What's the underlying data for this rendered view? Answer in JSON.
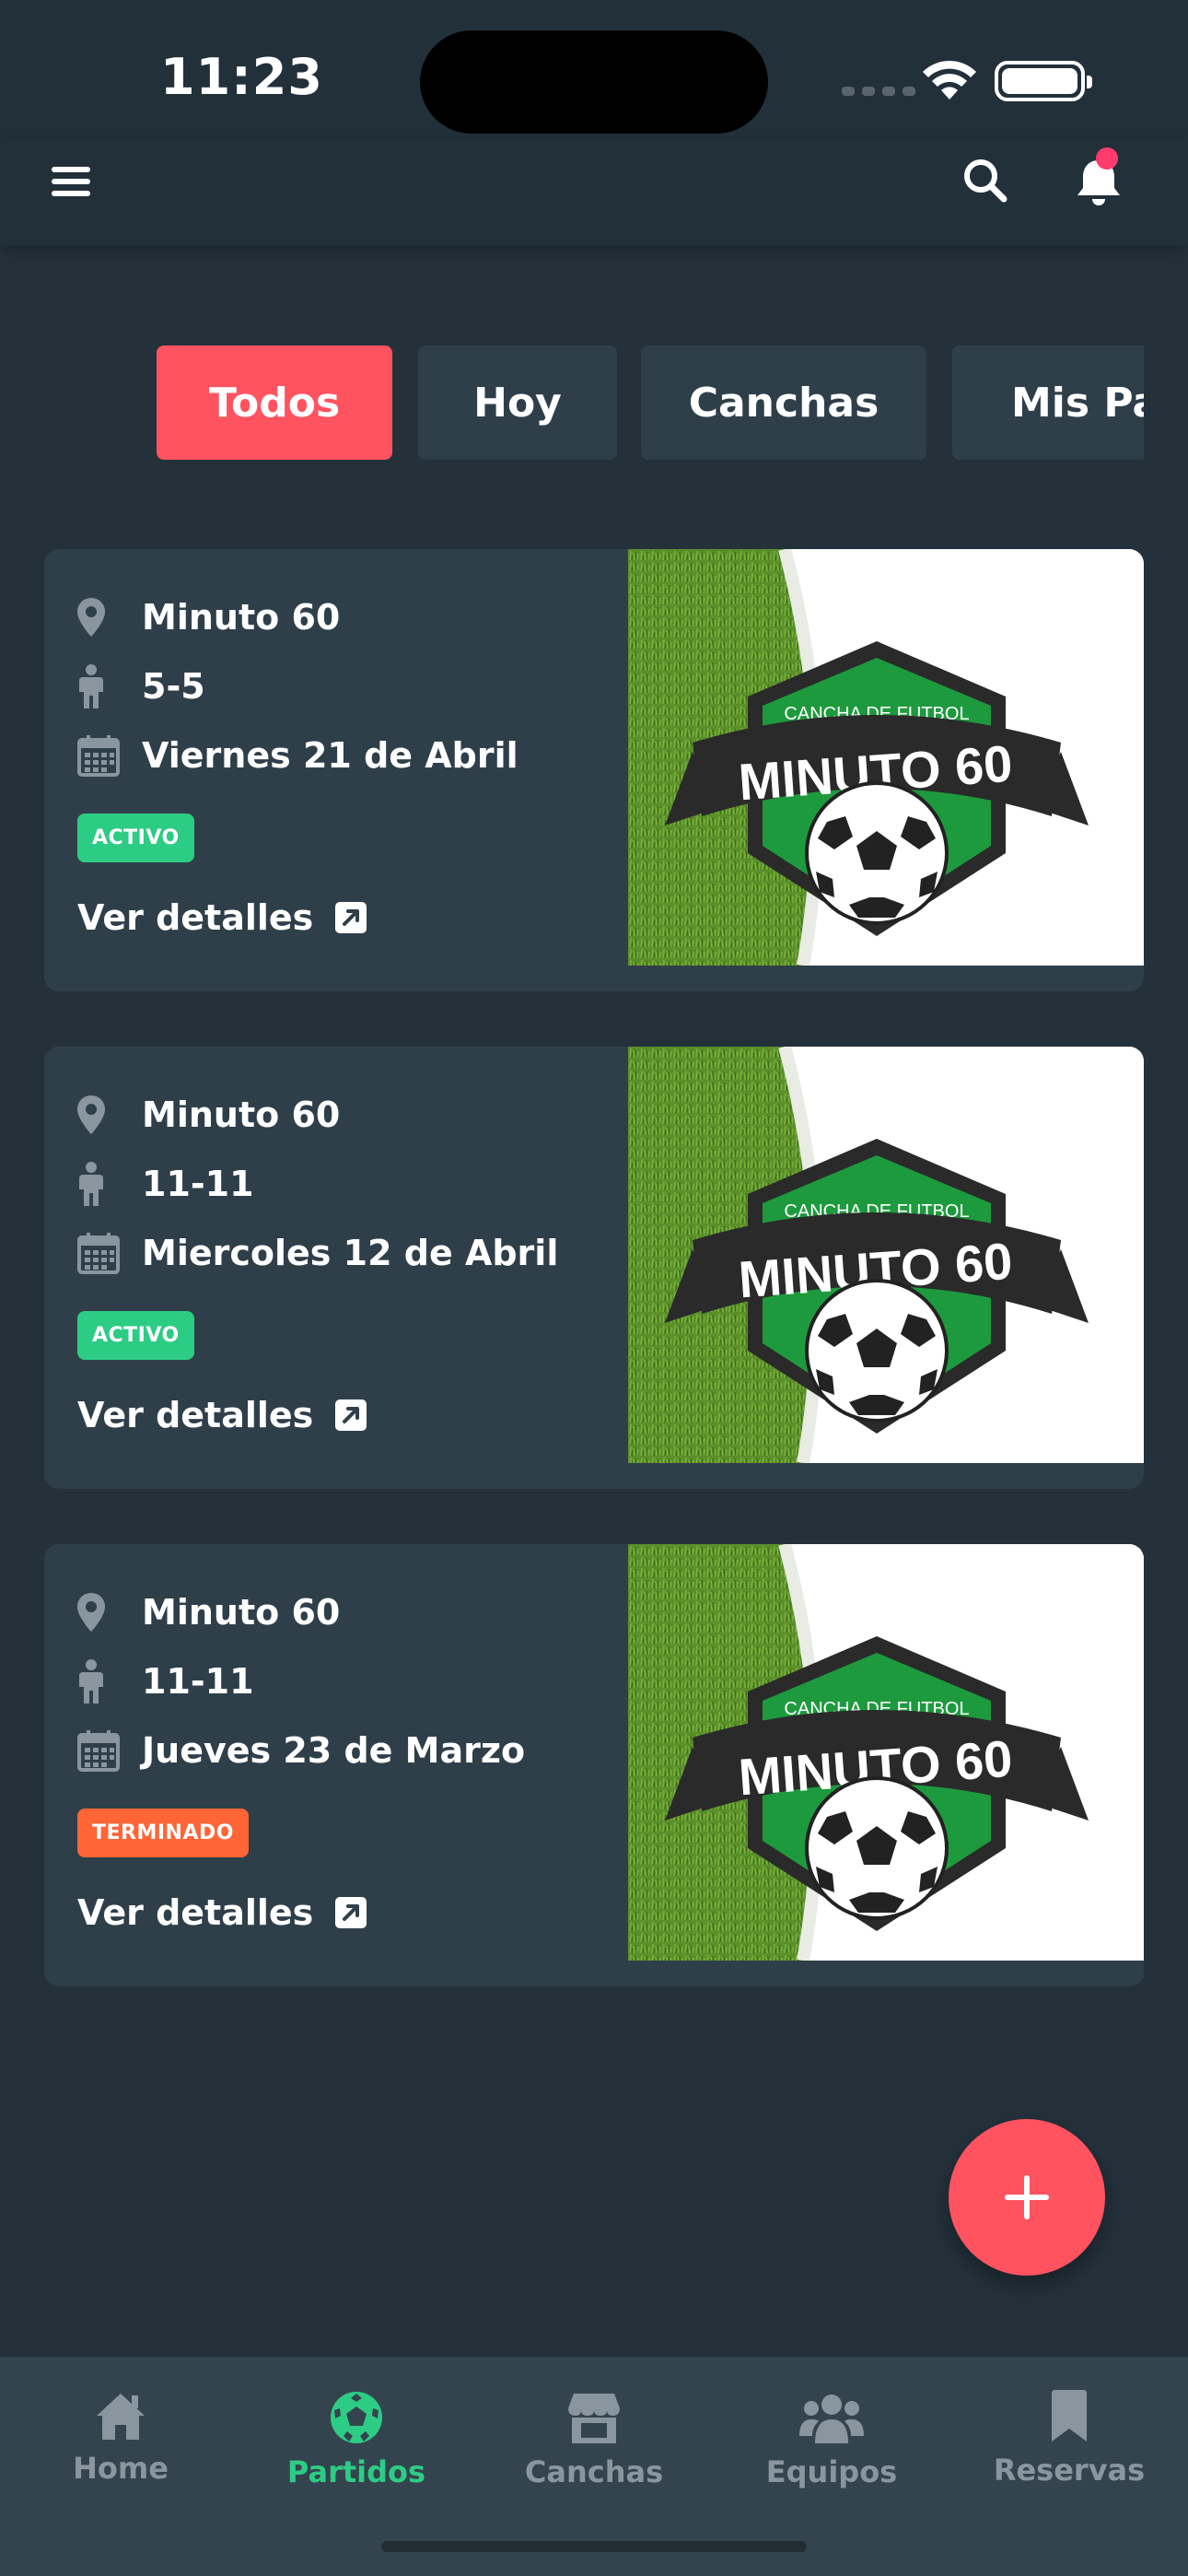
{
  "status_bar": {
    "time": "11:23"
  },
  "filters": {
    "items": [
      {
        "label": "Todos",
        "active": true
      },
      {
        "label": "Hoy",
        "active": false
      },
      {
        "label": "Canchas",
        "active": false
      },
      {
        "label": "Mis Partidos",
        "active": false
      }
    ]
  },
  "matches": [
    {
      "venue": "Minuto 60",
      "format": "5-5",
      "date": "Viernes 21 de Abril",
      "status": "ACTIVO",
      "details_label": "Ver detalles",
      "logo": {
        "top_text": "CANCHA DE FUTBOL",
        "main_text": "MINUTO 60"
      }
    },
    {
      "venue": "Minuto 60",
      "format": "11-11",
      "date": "Miercoles 12 de Abril",
      "status": "ACTIVO",
      "details_label": "Ver detalles",
      "logo": {
        "top_text": "CANCHA DE FUTBOL",
        "main_text": "MINUTO 60"
      }
    },
    {
      "venue": "Minuto 60",
      "format": "11-11",
      "date": "Jueves 23 de Marzo",
      "status": "TERMINADO",
      "details_label": "Ver detalles",
      "logo": {
        "top_text": "CANCHA DE FUTBOL",
        "main_text": "MINUTO 60"
      }
    }
  ],
  "bottom_nav": {
    "items": [
      {
        "label": "Home",
        "icon": "home-icon",
        "active": false
      },
      {
        "label": "Partidos",
        "icon": "soccer-ball-icon",
        "active": true
      },
      {
        "label": "Canchas",
        "icon": "store-icon",
        "active": false
      },
      {
        "label": "Equipos",
        "icon": "users-icon",
        "active": false
      },
      {
        "label": "Reservas",
        "icon": "bookmark-icon",
        "active": false
      }
    ]
  },
  "colors": {
    "background": "#24313b",
    "card": "#2f3f4a",
    "accent": "#ff5360",
    "active_green": "#2dcc85",
    "finished_orange": "#ff6537",
    "nav_inactive": "#8a969f"
  }
}
